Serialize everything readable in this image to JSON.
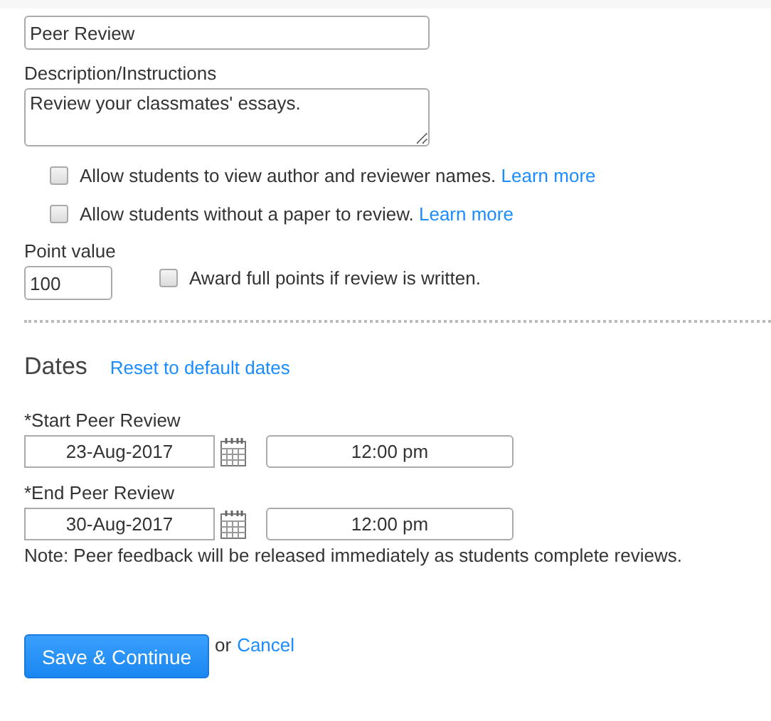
{
  "title_field": {
    "value": "Peer Review"
  },
  "description": {
    "label": "Description/Instructions",
    "value": "Review your classmates' essays."
  },
  "options": [
    {
      "label": "Allow students to view author and reviewer names.",
      "link": "Learn more",
      "checked": false
    },
    {
      "label": "Allow students without a paper to review.",
      "link": "Learn more",
      "checked": false
    }
  ],
  "points": {
    "label": "Point value",
    "value": "100",
    "award": {
      "label": "Award full points if review is written.",
      "checked": false
    }
  },
  "dates": {
    "heading": "Dates",
    "reset_link": "Reset to default dates",
    "rows": [
      {
        "label": "*Start Peer Review",
        "date": "23-Aug-2017",
        "time": "12:00 pm"
      },
      {
        "label": "*End Peer Review",
        "date": "30-Aug-2017",
        "time": "12:00 pm"
      }
    ],
    "note": "Note: Peer feedback will be released immediately as students complete reviews."
  },
  "actions": {
    "save": "Save & Continue",
    "or": "or",
    "cancel": "Cancel"
  }
}
